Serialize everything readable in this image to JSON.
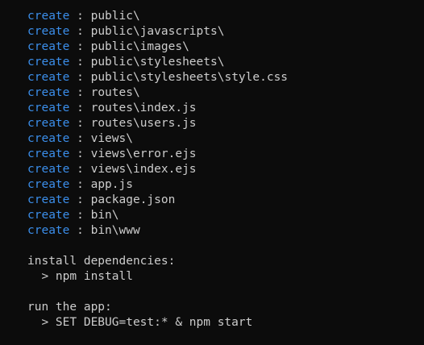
{
  "terminal": {
    "created_files": [
      {
        "keyword": "create",
        "separator": " : ",
        "path": "public\\"
      },
      {
        "keyword": "create",
        "separator": " : ",
        "path": "public\\javascripts\\"
      },
      {
        "keyword": "create",
        "separator": " : ",
        "path": "public\\images\\"
      },
      {
        "keyword": "create",
        "separator": " : ",
        "path": "public\\stylesheets\\"
      },
      {
        "keyword": "create",
        "separator": " : ",
        "path": "public\\stylesheets\\style.css"
      },
      {
        "keyword": "create",
        "separator": " : ",
        "path": "routes\\"
      },
      {
        "keyword": "create",
        "separator": " : ",
        "path": "routes\\index.js"
      },
      {
        "keyword": "create",
        "separator": " : ",
        "path": "routes\\users.js"
      },
      {
        "keyword": "create",
        "separator": " : ",
        "path": "views\\"
      },
      {
        "keyword": "create",
        "separator": " : ",
        "path": "views\\error.ejs"
      },
      {
        "keyword": "create",
        "separator": " : ",
        "path": "views\\index.ejs"
      },
      {
        "keyword": "create",
        "separator": " : ",
        "path": "app.js"
      },
      {
        "keyword": "create",
        "separator": " : ",
        "path": "package.json"
      },
      {
        "keyword": "create",
        "separator": " : ",
        "path": "bin\\"
      },
      {
        "keyword": "create",
        "separator": " : ",
        "path": "bin\\www"
      }
    ],
    "install_heading": "install dependencies:",
    "install_command": "  > npm install",
    "run_heading": "run the app:",
    "run_command": "  > SET DEBUG=test:* & npm start"
  },
  "colors": {
    "background": "#0c0c0c",
    "keyword": "#3b8eea",
    "text": "#cccccc"
  }
}
